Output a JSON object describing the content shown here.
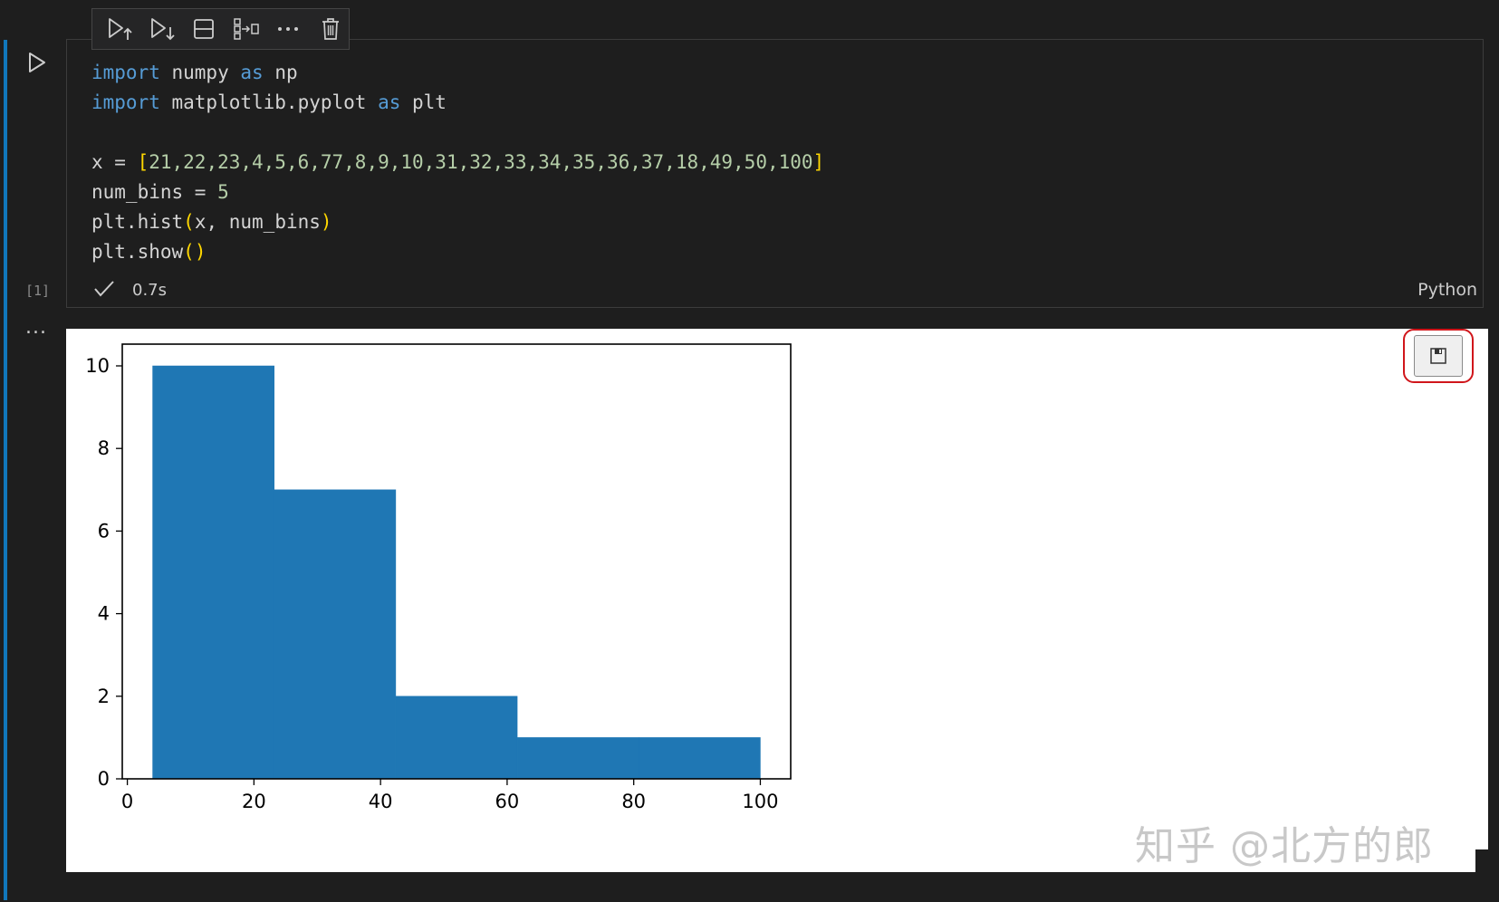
{
  "cell": {
    "toolbar": {
      "items": [
        {
          "name": "execute-above-icon"
        },
        {
          "name": "execute-below-icon"
        },
        {
          "name": "split-cell-icon"
        },
        {
          "name": "join-cells-icon"
        },
        {
          "name": "more-actions-icon"
        },
        {
          "name": "delete-cell-icon"
        }
      ]
    },
    "code": {
      "line1": {
        "kw1": "import",
        "mod": " numpy ",
        "kw2": "as",
        "alias": " np"
      },
      "line2": {
        "kw1": "import",
        "mod": " matplotlib.pyplot ",
        "kw2": "as",
        "alias": " plt"
      },
      "line3": {
        "assign": "x = ",
        "open": "[",
        "values": "21,22,23,4,5,6,77,8,9,10,31,32,33,34,35,36,37,18,49,50,100",
        "close": "]"
      },
      "line4": {
        "text": "num_bins = ",
        "num": "5"
      },
      "line5": {
        "call": "plt.hist",
        "open": "(",
        "args": "x, num_bins",
        "close": ")"
      },
      "line6": {
        "call": "plt.show",
        "open": "(",
        "close": ")"
      }
    },
    "execution_count": "[1]",
    "status_time": "0.7s",
    "language": "Python",
    "output_ellipsis": "..."
  },
  "watermark": "知乎 @北方的郎",
  "colors": {
    "accent": "#1177bb",
    "bar": "#1f77b4",
    "highlight": "#d0161b"
  },
  "chart_data": {
    "type": "bar",
    "bin_edges": [
      4,
      23.2,
      42.4,
      61.6,
      80.8,
      100
    ],
    "values": [
      10,
      7,
      2,
      1,
      1
    ],
    "xlim": [
      4,
      100
    ],
    "ylim": [
      0,
      10
    ],
    "xticks": [
      0,
      20,
      40,
      60,
      80,
      100
    ],
    "yticks": [
      0,
      2,
      4,
      6,
      8,
      10
    ],
    "title": "",
    "xlabel": "",
    "ylabel": "",
    "grid": false
  }
}
